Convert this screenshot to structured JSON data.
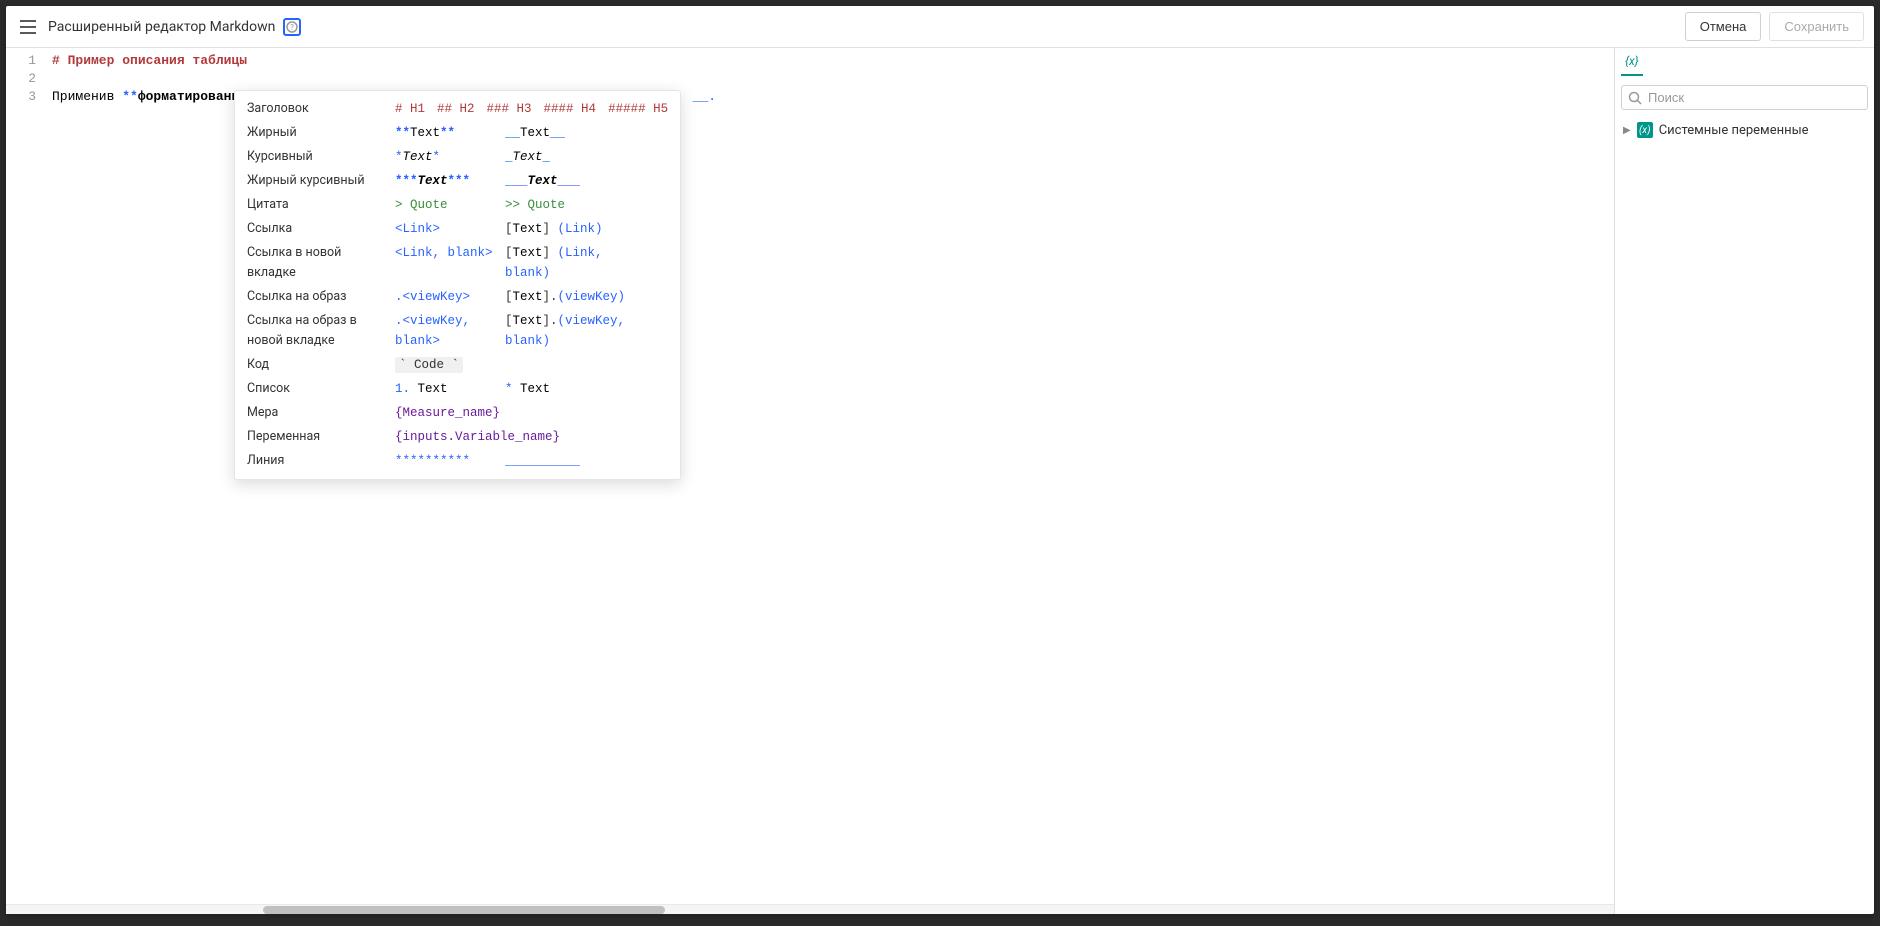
{
  "header": {
    "title": "Расширенный редактор Markdown",
    "cancel": "Отмена",
    "save": "Сохранить"
  },
  "editor": {
    "lines": [
      "1",
      "2",
      "3"
    ],
    "line1": "# Пример описания таблицы",
    "line3_a": "Применив ",
    "line3_b": "**",
    "line3_c": "форматирование",
    "line3_d": "**",
    "line3_trail": "__."
  },
  "tooltip": {
    "rows": {
      "header_label": "Заголовок",
      "h1": "# H1",
      "h2": "## H2",
      "h3": "### H3",
      "h4": "#### H4",
      "h5": "##### H5",
      "bold_label": "Жирный",
      "bold_a1": "**",
      "bold_a2": "Text",
      "bold_a3": "**",
      "bold_b1": "__",
      "bold_b2": "Text",
      "bold_b3": "__",
      "italic_label": "Курсивный",
      "italic_a1": "*",
      "italic_a2": "Text",
      "italic_a3": "*",
      "italic_b1": "_",
      "italic_b2": "Text",
      "italic_b3": "_",
      "bolditalic_label": "Жирный курсивный",
      "bi_a1": "***",
      "bi_a2": "Text",
      "bi_a3": "***",
      "bi_b1": "___",
      "bi_b2": "Text",
      "bi_b3": "___",
      "quote_label": "Цитата",
      "quote_a": "> Quote",
      "quote_b": ">> Quote",
      "link_label": "Ссылка",
      "link_a": "<Link>",
      "link_b1": "[",
      "link_b2": "Text",
      "link_b3": "]",
      "link_b4": " (Link)",
      "linknew_label": "Ссылка в новой вкладке",
      "linknew_a": "<Link, blank>",
      "linknew_b1": "[",
      "linknew_b2": "Text",
      "linknew_b3": "]",
      "linknew_b4": " (Link, blank)",
      "linkview_label": "Ссылка на образ",
      "linkview_a": ".<viewKey>",
      "linkview_b1": "[",
      "linkview_b2": "Text",
      "linkview_b3": "].",
      "linkview_b4": "(viewKey)",
      "linkviewnew_label": "Ссылка на образ в новой вкладке",
      "linkviewnew_a": ".<viewKey, blank>",
      "linkviewnew_b1": "[",
      "linkviewnew_b2": "Text",
      "linkviewnew_b3": "].",
      "linkviewnew_b4": "(viewKey, blank)",
      "code_label": "Код",
      "code_a": "` Code `",
      "list_label": "Список",
      "list_a1": "1.",
      "list_a2": " Text",
      "list_b1": "*",
      "list_b2": " Text",
      "measure_label": "Мера",
      "measure_a": "{Measure_name}",
      "var_label": "Переменная",
      "var_a": "{inputs.Variable_name}",
      "line_label": "Линия",
      "line_a": "**********",
      "line_b": "__________"
    }
  },
  "right": {
    "tab": "{x}",
    "search_placeholder": "Поиск",
    "tree_vars": "Системные переменные",
    "tree_icon": "(x)"
  }
}
